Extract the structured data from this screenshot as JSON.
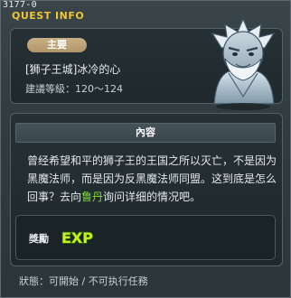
{
  "window": {
    "quest_id": "3177-0",
    "title": "QUEST INFO"
  },
  "quest": {
    "category_badge": "主要",
    "name": "[狮子王城]冰冷的心",
    "level_range": "建議等級：120～124",
    "npc_portrait_icon": "ice-knight-npc-portrait-icon"
  },
  "content": {
    "header": "內容",
    "body_before_npc": "曾经希望和平的狮子王的王国之所以灭亡，不是因为黑魔法师，而是因为反黑魔法师同盟。这到底是怎么回事？去向",
    "npc_name": "鲁丹",
    "body_after_npc": "询问详细的情况吧。",
    "npc_link_color": "#7fdc3a"
  },
  "reward": {
    "label": "獎勵",
    "icon": "exp-icon",
    "icon_text": "EXP"
  },
  "status": {
    "text": "狀態：可開始 / 不可执行任務"
  },
  "colors": {
    "title": "#f0c534",
    "badge": "#b9a074",
    "background": "#323c40"
  }
}
